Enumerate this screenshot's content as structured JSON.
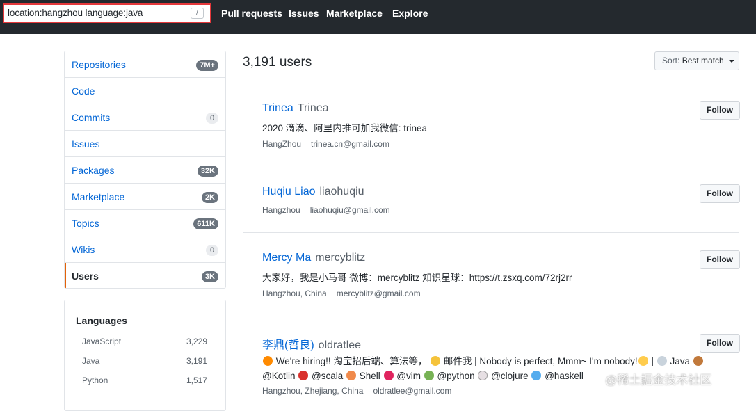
{
  "header": {
    "search": {
      "value": "location:hangzhou language:java",
      "shortcut_key": "/"
    },
    "nav": [
      "Pull requests",
      "Issues",
      "Marketplace",
      "Explore"
    ]
  },
  "sidebar": {
    "items": [
      {
        "label": "Repositories",
        "count": "7M+"
      },
      {
        "label": "Code",
        "count": ""
      },
      {
        "label": "Commits",
        "count": "0"
      },
      {
        "label": "Issues",
        "count": ""
      },
      {
        "label": "Packages",
        "count": "32K"
      },
      {
        "label": "Marketplace",
        "count": "2K"
      },
      {
        "label": "Topics",
        "count": "611K"
      },
      {
        "label": "Wikis",
        "count": "0"
      },
      {
        "label": "Users",
        "count": "3K",
        "selected": true
      }
    ],
    "languages": {
      "title": "Languages",
      "items": [
        {
          "name": "JavaScript",
          "count": "3,229"
        },
        {
          "name": "Java",
          "count": "3,191"
        },
        {
          "name": "Python",
          "count": "1,517"
        }
      ]
    }
  },
  "results": {
    "title": "3,191 users",
    "sort": {
      "prefix": "Sort:",
      "value": "Best match"
    },
    "follow_label": "Follow",
    "users": [
      {
        "name": "Trinea",
        "login": "Trinea",
        "bio": "2020 滴滴、阿里内推可加我微信: trinea",
        "location": "HangZhou",
        "email": "trinea.cn@gmail.com"
      },
      {
        "name": "Huqiu Liao",
        "login": "liaohuqiu",
        "bio": "",
        "location": "Hangzhou",
        "email": "liaohuqiu@gmail.com"
      },
      {
        "name": "Mercy Ma",
        "login": "mercyblitz",
        "bio": "大家好，我是小马哥 微博：mercyblitz 知识星球：https://t.zsxq.com/72rj2rr",
        "location": "Hangzhou, China",
        "email": "mercyblitz@gmail.com"
      },
      {
        "name": "李鼎(哲良)",
        "login": "oldratlee",
        "bio_line1": [
          " We're hiring!! 淘宝招后端、算法等， ",
          " 邮件我 | Nobody is perfect, Mmm~ I'm nobody!",
          " | ",
          " Java "
        ],
        "bio_line2": [
          " @Kotlin ",
          " @scala ",
          " Shell ",
          " @vim ",
          " @python ",
          " @clojure ",
          " @haskell"
        ],
        "location": "Hangzhou, Zhejiang, China",
        "email": "oldratlee@gmail.com"
      }
    ]
  },
  "watermark": "@稀土掘金技术社区"
}
